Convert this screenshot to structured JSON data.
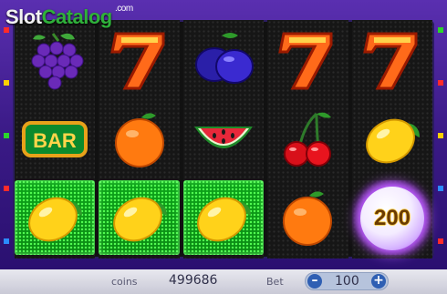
{
  "logo": {
    "slot": "Slot",
    "catalog": "Catalog",
    "com": ".com"
  },
  "reels": [
    [
      "grapes",
      "bar",
      "lemon"
    ],
    [
      "seven",
      "orange",
      "lemon"
    ],
    [
      "plum",
      "watermelon",
      "lemon"
    ],
    [
      "seven",
      "cherry",
      "orange"
    ],
    [
      "seven",
      "lemon",
      "bonus"
    ]
  ],
  "symbol_labels": {
    "bar": "BAR"
  },
  "bonus": {
    "value": "200"
  },
  "footer": {
    "coins_label": "coins",
    "coins_value": "499686",
    "bet_label": "Bet",
    "bet_value": "100",
    "minus_label": "–",
    "plus_label": "+"
  },
  "colors": {
    "frame": "#4a26a0",
    "win_highlight": "#0da31a",
    "bonus_glow": "#c060ff",
    "bet_button": "#2f5fb3"
  }
}
